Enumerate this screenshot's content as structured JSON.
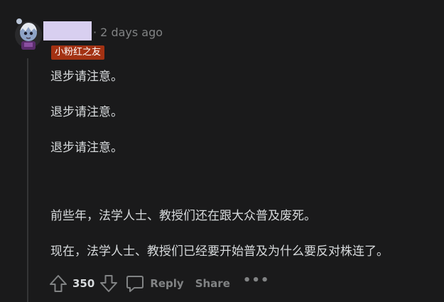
{
  "comment": {
    "meta": "· 2 days ago",
    "flair": "小粉红之友",
    "paragraphs": [
      "退步请注意。",
      "退步请注意。",
      "退步请注意。",
      "前些年，法学人士、教授们还在跟大众普及废死。",
      "现在，法学人士、教授们已经要开始普及为什么要反对株连了。"
    ]
  },
  "actions": {
    "score": "350",
    "reply_label": "Reply",
    "share_label": "Share",
    "more_label": "•••"
  },
  "icons": {
    "upvote": "upvote-arrow-icon",
    "downvote": "downvote-arrow-icon",
    "reply": "speech-bubble-icon",
    "more": "ellipsis-icon"
  },
  "colors": {
    "background": "#1a1a1b",
    "text": "#d7dadc",
    "muted": "#818384",
    "flair_bg": "#a33213",
    "redaction": "#d8cff0"
  }
}
